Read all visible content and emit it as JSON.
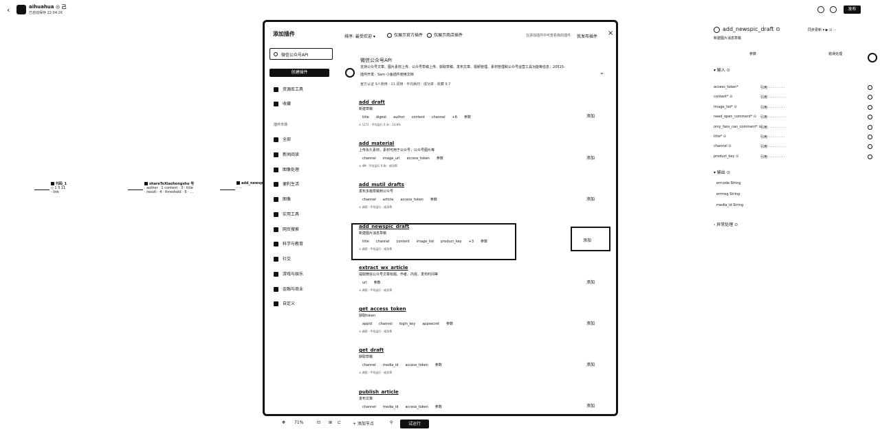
{
  "header": {
    "back_icon": "‹",
    "app_name": "aihuahua ◎ 己",
    "app_sub": "已自动保存 22:04:26",
    "publish_label": "发布"
  },
  "canvas": {
    "nodes": [
      {
        "title": "代码_1",
        "line1": "◇ 1 5 11",
        "line2": "· link"
      },
      {
        "title": "shareToXiaohongshu 号",
        "line1": "· author · 1 content · 3 · title",
        "line2": "· result · 4 · threshold · 5 · ..."
      },
      {
        "title": "add_newsp...",
        "line1": "· ...",
        "line2": "· ..."
      }
    ]
  },
  "modal": {
    "title": "添加插件",
    "sort_label": "排序: 最受欢迎 ▾",
    "filter1": "仅展示官方插件",
    "filter2": "仅展示商店插件",
    "my_plugins_link": "在添加插件中可查看我的插件",
    "create_link": "我发布插件",
    "search_placeholder": "微信公众号API",
    "create_button": "创建插件",
    "side_top": [
      {
        "label": "资源库工具"
      },
      {
        "label": "收藏"
      }
    ],
    "side_section": "插件市场",
    "categories": [
      {
        "label": "全部"
      },
      {
        "label": "新闻阅读"
      },
      {
        "label": "图像处理"
      },
      {
        "label": "便利生活"
      },
      {
        "label": "图像"
      },
      {
        "label": "实用工具"
      },
      {
        "label": "网页搜索"
      },
      {
        "label": "科学与教育"
      },
      {
        "label": "社交"
      },
      {
        "label": "游戏与娱乐"
      },
      {
        "label": "金融与商业"
      },
      {
        "label": "自定义"
      }
    ],
    "hero": {
      "name": "微信公众号API",
      "desc": "支持公众号文章、图片素材上传、公众号草稿上传、获取草稿、发布文章、视频管理、素材管理和公众号运营工具功能等信息：20515-",
      "meta": "插件开发：Sam 小鱼插件使用文档",
      "stats": "官方认证 9人使用 · 11 调用 · 平均耗时 · 成功率 · 收藏 9.7"
    },
    "plugins": [
      {
        "name": "add_draft",
        "desc": "新建草稿",
        "params": [
          "title",
          "digest",
          "author",
          "content",
          "channel",
          "+6",
          "参数"
        ],
        "meta": "⊙ 1271 · 平均运行 0.3s · 14.8%",
        "add": "添加"
      },
      {
        "name": "add_material",
        "desc": "上传永久素材，素材可用于公众号，公众号图片等",
        "params": [
          "channel",
          "image_url",
          "access_token",
          "参数"
        ],
        "meta": "⊙ 4M · 平均运行 0.8s · 成功率",
        "add": "添加"
      },
      {
        "name": "add_mutil_drafts",
        "desc": "发布多篇草稿到公众号",
        "params": [
          "channel",
          "article",
          "access_token",
          "参数"
        ],
        "meta": "⊙ 调用 · 平均运行 · 成功率",
        "add": "添加"
      },
      {
        "name": "add_newspic_draft",
        "desc": "新建图片消息草稿",
        "params": [
          "title",
          "channel",
          "content",
          "image_list",
          "product_key",
          "+3",
          "参数"
        ],
        "meta": "⊙ 调用 · 平均运行 · 成功率",
        "add": "添加"
      },
      {
        "name": "extract_wx_article",
        "desc": "提取微信公众号文章标题、作者、内容、发布时间等",
        "params": [
          "url",
          "参数"
        ],
        "meta": "⊙ 调用 · 平均运行 · 成功率",
        "add": "添加"
      },
      {
        "name": "get_access_token",
        "desc": "获取token",
        "params": [
          "appid",
          "channel",
          "login_key",
          "appsecret",
          "参数"
        ],
        "meta": "⊙ 调用 · 平均运行 · 成功率",
        "add": "添加"
      },
      {
        "name": "get_draft",
        "desc": "获取草稿",
        "params": [
          "channel",
          "media_id",
          "access_token",
          "参数"
        ],
        "meta": "⊙ 调用 · 平均运行 · 成功率",
        "add": "添加"
      },
      {
        "name": "publish_article",
        "desc": "发布文章",
        "params": [
          "channel",
          "media_id",
          "access_token",
          "参数"
        ],
        "meta": "",
        "add": "添加"
      }
    ]
  },
  "toolbar": {
    "zoom": "71%",
    "add_node": "+ 添加节点",
    "run_label": "试运行"
  },
  "right_panel": {
    "title": "add_newspic_draft ⊙",
    "subtitle": "新建图片消息草稿",
    "tabs": [
      {
        "label": "参数"
      },
      {
        "label": "错误处理"
      }
    ],
    "input_section": "▾ 输入 ⊙",
    "inputs": [
      {
        "name": "access_token*",
        "value": "引用 · · · · · · · ·"
      },
      {
        "name": "content* ⊙",
        "value": "引用 · · · · · · · ·"
      },
      {
        "name": "image_list* ⊙",
        "value": "引用 · · · · · · · ·"
      },
      {
        "name": "need_open_comment* ⊙",
        "value": "引用 · · · · · · · ·"
      },
      {
        "name": "only_fans_can_comment* ⊙",
        "value": "引用 · · · · · · · ·"
      },
      {
        "name": "title* ⊙",
        "value": "引用 · · · · · · · ·"
      },
      {
        "name": "channel ⊙",
        "value": "引用 · · · · · · · ·"
      },
      {
        "name": "product_key ⊙",
        "value": "引用 · · · · · · · ·"
      }
    ],
    "output_section": "▾ 输出 ⊙",
    "outputs": [
      {
        "label": "errcode  String"
      },
      {
        "label": "errmsg  String"
      },
      {
        "label": "media_id  String"
      }
    ],
    "exception_section": "› 异常处理 ⊙",
    "actions": "同步更新 ▾  ▶  ⊙  ⋯"
  }
}
